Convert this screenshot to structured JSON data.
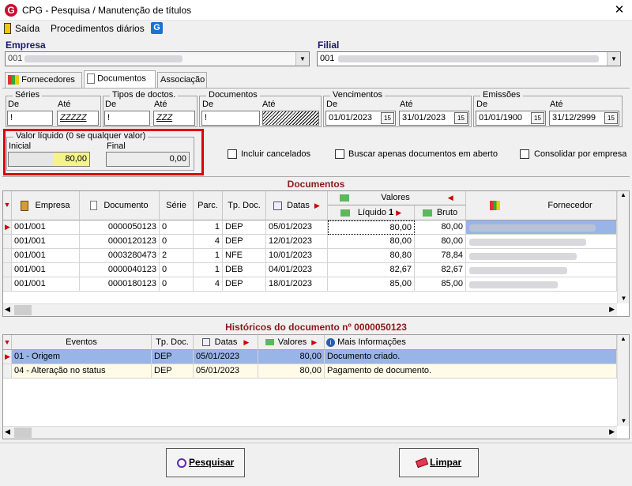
{
  "window": {
    "logo": "G",
    "title": "CPG - Pesquisa / Manutenção de títulos",
    "close": "✕"
  },
  "menu": {
    "exit": "Saída",
    "daily": "Procedimentos diários",
    "g": "G"
  },
  "empresa": {
    "label": "Empresa",
    "value": "001"
  },
  "filial": {
    "label": "Filial",
    "value": "001"
  },
  "tabs": [
    {
      "label": "Fornecedores"
    },
    {
      "label": "Documentos"
    },
    {
      "label": "Associação"
    }
  ],
  "filters": {
    "series": {
      "title": "Séries",
      "de": "De",
      "ate": "Até",
      "de_val": "!",
      "ate_val": "ZZZZZ"
    },
    "tipos": {
      "title": "Tipos de doctos.",
      "de": "De",
      "ate": "Até",
      "de_val": "!",
      "ate_val": "ZZZ"
    },
    "documentos": {
      "title": "Documentos",
      "de": "De",
      "ate": "Até",
      "de_val": "!",
      "ate_val": ""
    },
    "vencimentos": {
      "title": "Vencimentos",
      "de": "De",
      "ate": "Até",
      "de_val": "01/01/2023",
      "ate_val": "31/01/2023"
    },
    "emissoes": {
      "title": "Emissões",
      "de": "De",
      "ate": "Até",
      "de_val": "01/01/1900",
      "ate_val": "31/12/2999"
    },
    "valor": {
      "title": "Valor líquido (0 se qualquer valor)",
      "inicial": "Inicial",
      "final": "Final",
      "inicial_val": "80,00",
      "final_val": "0,00"
    },
    "cancelados": "Incluir cancelados",
    "abertos": "Buscar apenas documentos em aberto",
    "consolidar": "Consolidar por empresa"
  },
  "docs": {
    "title": "Documentos",
    "headers": {
      "empresa": "Empresa",
      "documento": "Documento",
      "serie": "Série",
      "parc": "Parc.",
      "tipo": "Tp. Doc.",
      "datas": "Datas",
      "valores": "Valores",
      "liquido": "Líquido",
      "bruto": "Bruto",
      "fornecedor": "Fornecedor",
      "sort": "1"
    },
    "rows": [
      {
        "empresa": "001/001",
        "documento": "0000050123",
        "serie": "0",
        "parc": "1",
        "tipo": "DEP",
        "data": "05/01/2023",
        "liquido": "80,00",
        "bruto": "80,00"
      },
      {
        "empresa": "001/001",
        "documento": "0000120123",
        "serie": "0",
        "parc": "4",
        "tipo": "DEP",
        "data": "12/01/2023",
        "liquido": "80,00",
        "bruto": "80,00"
      },
      {
        "empresa": "001/001",
        "documento": "0003280473",
        "serie": "2",
        "parc": "1",
        "tipo": "NFE",
        "data": "10/01/2023",
        "liquido": "80,80",
        "bruto": "78,84"
      },
      {
        "empresa": "001/001",
        "documento": "0000040123",
        "serie": "0",
        "parc": "1",
        "tipo": "DEB",
        "data": "04/01/2023",
        "liquido": "82,67",
        "bruto": "82,67"
      },
      {
        "empresa": "001/001",
        "documento": "0000180123",
        "serie": "0",
        "parc": "4",
        "tipo": "DEP",
        "data": "18/01/2023",
        "liquido": "85,00",
        "bruto": "85,00"
      }
    ]
  },
  "hist": {
    "title": "Históricos do documento nº 0000050123",
    "headers": {
      "eventos": "Eventos",
      "tipo": "Tp. Doc.",
      "datas": "Datas",
      "valores": "Valores",
      "info": "Mais Informações"
    },
    "rows": [
      {
        "evento": "01 - Origem",
        "tipo": "DEP",
        "data": "05/01/2023",
        "valor": "80,00",
        "info": "Documento criado."
      },
      {
        "evento": "04 - Alteração no status",
        "tipo": "DEP",
        "data": "05/01/2023",
        "valor": "80,00",
        "info": "Pagamento de documento."
      }
    ]
  },
  "buttons": {
    "pesquisar": "Pesquisar",
    "limpar": "Limpar"
  },
  "colors": {
    "highlight": "#e00000",
    "selected": "#99b4e6",
    "titleRed": "#8b1a1a"
  }
}
